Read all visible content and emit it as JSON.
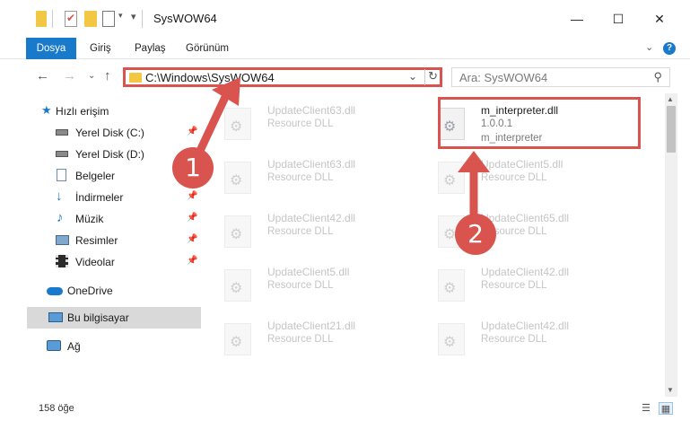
{
  "window": {
    "title": "SysWOW64",
    "minimize": "—",
    "maximize": "☐",
    "close": "✕"
  },
  "ribbon": {
    "tabs": [
      "Dosya",
      "Giriş",
      "Paylaş",
      "Görünüm"
    ],
    "expand": "⌄",
    "help": "?"
  },
  "nav": {
    "back": "←",
    "forward": "→",
    "recent": "⌄",
    "up": "↑",
    "address": "C:\\Windows\\SysWOW64",
    "address_chevron": "⌄",
    "refresh": "↻",
    "search_placeholder": "Ara: SysWOW64",
    "search_icon": "⚲"
  },
  "sidebar": {
    "items": [
      {
        "label": "Hızlı erişim",
        "icon": "star-icon",
        "pinned": false
      },
      {
        "label": "Yerel Disk (C:)",
        "icon": "drive-icon",
        "pinned": true
      },
      {
        "label": "Yerel Disk (D:)",
        "icon": "drive-icon",
        "pinned": false
      },
      {
        "label": "Belgeler",
        "icon": "document-icon",
        "pinned": true
      },
      {
        "label": "İndirmeler",
        "icon": "download-icon",
        "pinned": true
      },
      {
        "label": "Müzik",
        "icon": "music-icon",
        "pinned": true
      },
      {
        "label": "Resimler",
        "icon": "pictures-icon",
        "pinned": true
      },
      {
        "label": "Videolar",
        "icon": "video-icon",
        "pinned": true
      },
      {
        "label": "OneDrive",
        "icon": "cloud-icon",
        "pinned": false
      },
      {
        "label": "Bu bilgisayar",
        "icon": "computer-icon",
        "pinned": false
      },
      {
        "label": "Ağ",
        "icon": "network-icon",
        "pinned": false
      }
    ],
    "pin_glyph": "📌"
  },
  "files": {
    "left_column": [
      {
        "name": "UpdateClient63.dll",
        "type": "Resource DLL"
      },
      {
        "name": "UpdateClient63.dll",
        "type": "Resource DLL"
      },
      {
        "name": "UpdateClient42.dll",
        "type": "Resource DLL"
      },
      {
        "name": "UpdateClient5.dll",
        "type": "Resource DLL"
      },
      {
        "name": "UpdateClient21.dll",
        "type": "Resource DLL"
      }
    ],
    "right_column": [
      {
        "name": "m_interpreter.dll",
        "version": "1.0.0.1",
        "type": "m_interpreter"
      },
      {
        "name": "UpdateClient5.dll",
        "type": "Resource DLL"
      },
      {
        "name": "UpdateClient65.dll",
        "type": "Resource DLL"
      },
      {
        "name": "UpdateClient42.dll",
        "type": "Resource DLL"
      },
      {
        "name": "UpdateClient42.dll",
        "type": "Resource DLL"
      }
    ]
  },
  "status": {
    "count": "158 öğe"
  },
  "markers": [
    "1",
    "2"
  ],
  "colors": {
    "accent": "#1979ca",
    "highlight": "#d9534f",
    "folder": "#f2c744"
  }
}
